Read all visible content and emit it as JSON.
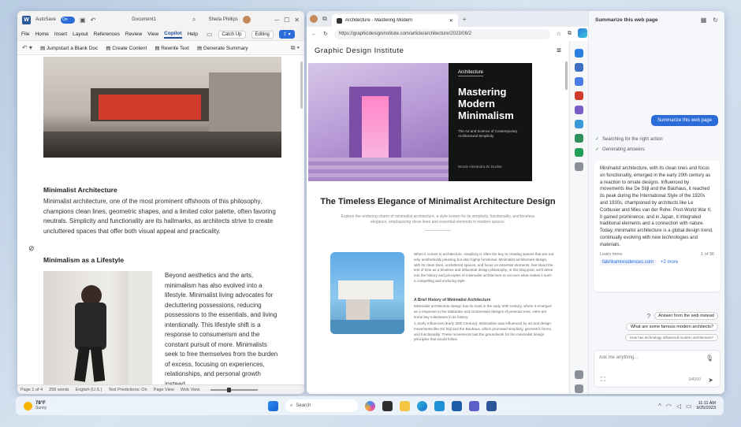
{
  "word": {
    "autosave_label": "AutoSave",
    "autosave_state": "On",
    "doc_title": "Document1",
    "user": "Sheila Phillips",
    "tabs": [
      "File",
      "Home",
      "Insert",
      "Layout",
      "References",
      "Review",
      "View",
      "Copilot",
      "Help"
    ],
    "active_tab": "Copilot",
    "catch_up": "Catch Up",
    "editing": "Editing",
    "ribbon": [
      "Jumpstart a Blank Doc",
      "Create Content",
      "Rewrite Text",
      "Generate Summary"
    ],
    "heading1": "Minimalist Architecture",
    "para1": "Minimalist architecture, one of the most prominent offshoots of this philosophy, champions clean lines, geometric shapes, and a limited color palette, often favoring neutrals. Simplicity and functionality are its hallmarks, as architects strive to create uncluttered spaces that offer both visual appeal and practicality.",
    "heading2": "Minimalism as a Lifestyle",
    "para2": "Beyond aesthetics and the arts, minimalism has also evolved into a lifestyle. Minimalist living advocates for decluttering possessions, reducing possessions to the essentials, and living intentionally. This lifestyle shift is a response to consumerism and the constant pursuit of more. Minimalists seek to free themselves from the burden of excess, focusing on experiences, relationships, and personal growth instead.",
    "status": {
      "page": "Page 1 of 4",
      "words": "256 words",
      "lang": "English (U.S.)",
      "predictions": "Text Predictions: On",
      "page_view": "Page View",
      "web_view": "Web View",
      "zoom": 0.35
    }
  },
  "edge": {
    "tab_title": "Architecture - Mastering Modern",
    "url": "https://graphicdesigninstitute.com/article/architecture/2023/08/2",
    "site_name": "Graphic Design Institute",
    "hero_label": "Architecture",
    "hero_title": "Mastering Modern Minimalism",
    "hero_sub": "The Art and Science of Contemporary Architectural Simplicity",
    "hero_author": "Words   Alexandra W. Dockie",
    "headline": "The Timeless Elegance of Minimalist Architecture Design",
    "intro": "Explore the enduring charm of minimalist architecture, a style known for its simplicity, functionality, and timeless elegance, emphasizing clean lines and essential elements in modern spaces.",
    "body1": "When it comes to architecture, simplicity is often the key to creating spaces that are not only aesthetically pleasing but also highly functional. Minimalist architecture design, with its clean lines, uncluttered spaces, and focus on essential elements, has stood the test of time as a timeless and influential design philosophy. In this blog post, we'll delve into the history and principles of minimalist architecture to uncover what makes it such a compelling and enduring style.",
    "subhead": "A Brief History of Minimalist Architecture",
    "body2": "Minimalist architecture design has its roots in the early 20th century, where it emerged as a response to the elaborate and ornamented designs of previous eras. Here are some key milestones in its history:",
    "body3": "1. Early Influences (Early 20th Century): Minimalism was influenced by art and design movements like De Stijl and the Bauhaus, which promoted simplicity, geometric forms, and functionality. These movements laid the groundwork for the minimalist design principles that would follow."
  },
  "copilot": {
    "title": "Summarize this web page",
    "user_msg": "Summarize this web page",
    "progress": [
      "Searching for the right action",
      "Generating answers"
    ],
    "answer": "Minimalist architecture, with its clean lines and focus on functionality, emerged in the early 20th century as a reaction to ornate designs. Influenced by movements like De Stijl and the Bauhaus, it reached its peak during the International Style of the 1920s and 1930s, championed by architects like Le Corbusier and Mies van der Rohe. Post-World War II, it gained prominence, and in Japan, it integrated traditional elements and a connection with nature. Today, minimalist architecture is a global design trend, continually evolving with new technologies and materials.",
    "learn_more": "Learn more:",
    "pager": "1 of 30",
    "source": "fabrikamresidences.com",
    "more": "+2 more",
    "suggestions": [
      "Answer from the web instead",
      "What are some famous modern architects?",
      "How has technology influenced modern architecture?"
    ],
    "placeholder": "Ask me anything...",
    "counter": "0/4000"
  },
  "taskbar": {
    "temp": "78°F",
    "weather": "Sunny",
    "search": "Search",
    "time": "11:11 AM",
    "date": "9/25/2023"
  }
}
